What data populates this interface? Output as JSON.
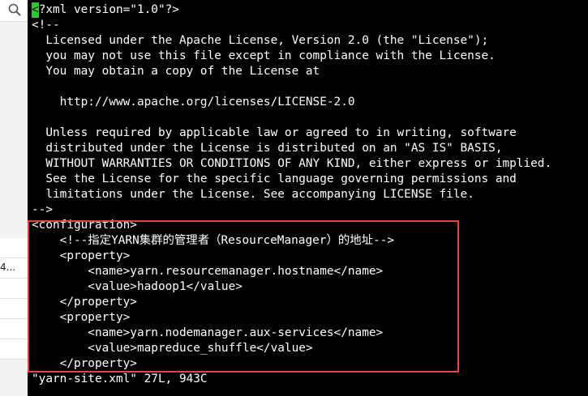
{
  "sidebar": {
    "rows": [
      {
        "label": ""
      },
      {
        "label": "4..."
      },
      {
        "label": ""
      },
      {
        "label": ""
      },
      {
        "label": ""
      },
      {
        "label": ""
      }
    ]
  },
  "editor": {
    "cursor_char": "<",
    "lines": [
      "?xml version=\"1.0\"?>",
      "<!--",
      "  Licensed under the Apache License, Version 2.0 (the \"License\");",
      "  you may not use this file except in compliance with the License.",
      "  You may obtain a copy of the License at",
      "",
      "    http://www.apache.org/licenses/LICENSE-2.0",
      "",
      "  Unless required by applicable law or agreed to in writing, software",
      "  distributed under the License is distributed on an \"AS IS\" BASIS,",
      "  WITHOUT WARRANTIES OR CONDITIONS OF ANY KIND, either express or implied.",
      "  See the License for the specific language governing permissions and",
      "  limitations under the License. See accompanying LICENSE file.",
      "-->",
      "<configuration>",
      "    <!--指定YARN集群的管理者（ResourceManager）的地址-->",
      "    <property>",
      "        <name>yarn.resourcemanager.hostname</name>",
      "        <value>hadoop1</value>",
      "    </property>",
      "    <property>",
      "        <name>yarn.nodemanager.aux-services</name>",
      "        <value>mapreduce_shuffle</value>",
      "    </property>"
    ],
    "status_line": "\"yarn-site.xml\" 27L, 943C"
  },
  "colors": {
    "background": "#000000",
    "text": "#ffffff",
    "cursor": "#1fd31f",
    "highlight_border": "#e8403c"
  }
}
